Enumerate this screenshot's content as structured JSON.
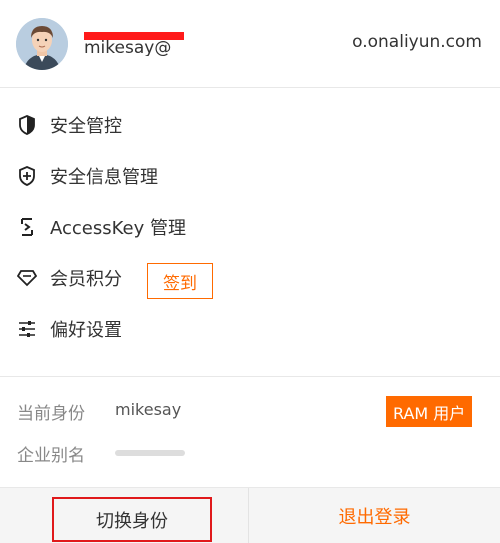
{
  "header": {
    "account_prefix": "mikesay@",
    "account_suffix": "o.onaliyun.com"
  },
  "menu": {
    "items": [
      {
        "label": "安全管控",
        "icon": "shield-icon"
      },
      {
        "label": "安全信息管理",
        "icon": "shield-plus-icon"
      },
      {
        "label": "AccessKey 管理",
        "icon": "key-bracket-icon"
      },
      {
        "label": "会员积分",
        "icon": "diamond-icon"
      },
      {
        "label": "偏好设置",
        "icon": "sliders-icon"
      }
    ],
    "signin_label": "签到"
  },
  "identity": {
    "current_label": "当前身份",
    "current_value": "mikesay",
    "ram_badge": "RAM 用户",
    "alias_label": "企业别名"
  },
  "footer": {
    "switch_label": "切换身份",
    "logout_label": "退出登录"
  },
  "colors": {
    "accent": "#ff6a00",
    "highlight_red": "#e0191b"
  }
}
